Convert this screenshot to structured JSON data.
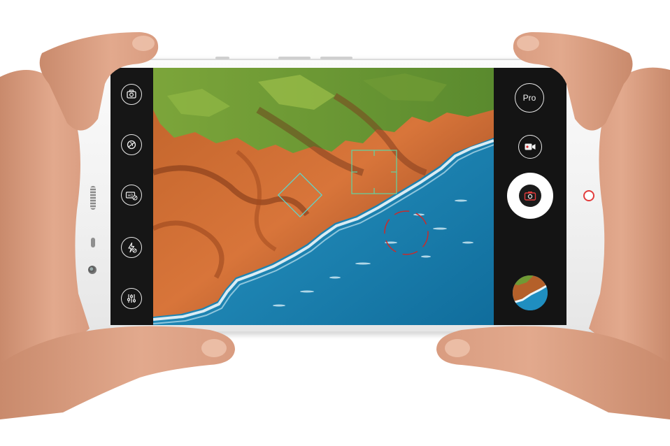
{
  "camera_app": {
    "left_toolbar": [
      {
        "name": "camera-switch-icon"
      },
      {
        "name": "filter-icon"
      },
      {
        "name": "hdr-off-icon"
      },
      {
        "name": "flash-off-icon"
      },
      {
        "name": "settings-sliders-icon"
      }
    ],
    "right_controls": {
      "pro_label": "Pro",
      "video_icon": "video-camera-icon",
      "shutter_icon": "camera-shutter-icon",
      "gallery_icon": "gallery-thumbnail"
    },
    "overlays": {
      "focus_box_color": "#5fd6a4",
      "diamond_color": "#5fd6c9",
      "exposure_ring_color": "#c92b2b"
    }
  },
  "device": {
    "home_button_color": "#e23c3c"
  }
}
